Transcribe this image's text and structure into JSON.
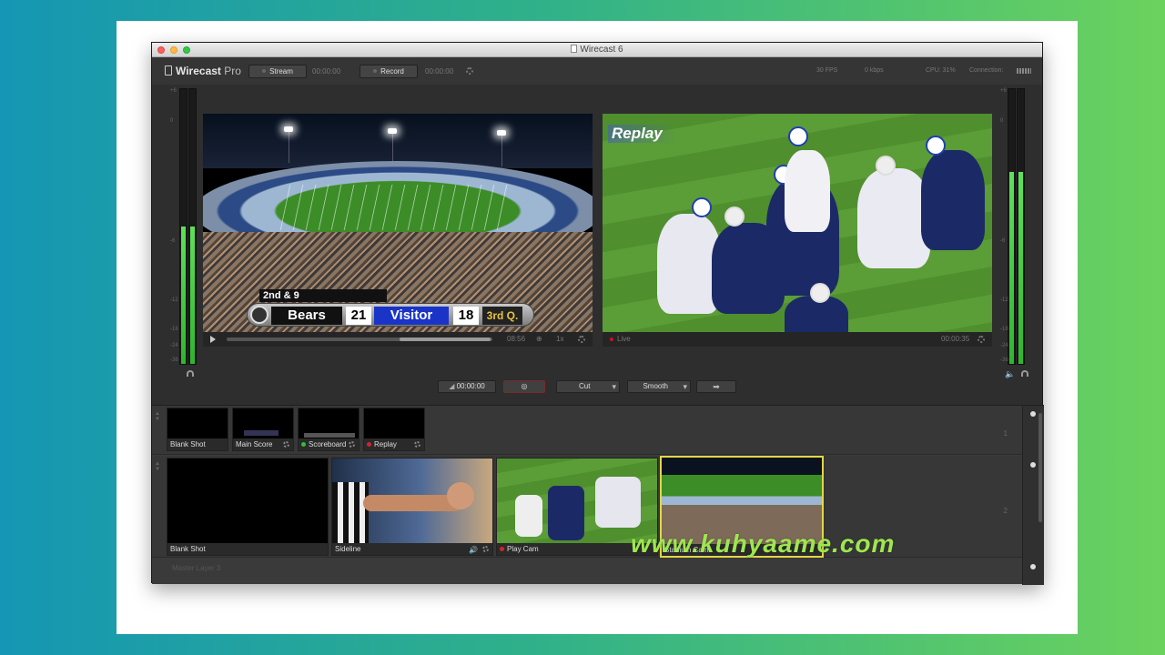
{
  "window": {
    "title": "Wirecast 6"
  },
  "toolbar": {
    "logo_main": "Wirecast",
    "logo_pro": "Pro",
    "stream_label": "Stream",
    "stream_time": "00:00:00",
    "record_label": "Record",
    "record_time": "00:00:00",
    "fps": "30 FPS",
    "kbps": "0 kbps",
    "cpu": "CPU:  31%",
    "connection": "Connection:"
  },
  "meters": {
    "left_scale": [
      "+6",
      "0",
      "-6",
      "-12",
      "-18",
      "-24",
      "-36"
    ],
    "right_scale": [
      "+6",
      "0",
      "-6",
      "-12",
      "-18",
      "-24",
      "-36"
    ],
    "left_level": 0.5,
    "right_level": 0.7
  },
  "preview": {
    "down_distance": "2nd & 9",
    "home_team": "Bears",
    "home_score": "21",
    "away_team": "Visitor",
    "away_score": "18",
    "quarter": "3rd Q.",
    "time": "08:56",
    "speed": "1x"
  },
  "live": {
    "overlay": "Replay",
    "status": "Live",
    "time": "00:00:35"
  },
  "transport": {
    "timecode": "00:00:00",
    "transition1": "Cut",
    "transition2": "Smooth"
  },
  "layer1": {
    "shots": [
      {
        "label": "Blank Shot"
      },
      {
        "label": "Main Score"
      },
      {
        "label": "Scoreboard",
        "dot": "#2fbf3a"
      },
      {
        "label": "Replay",
        "dot": "#d3262a"
      }
    ]
  },
  "layer2": {
    "shots": [
      {
        "label": "Blank Shot"
      },
      {
        "label": "Sideline"
      },
      {
        "label": "Play Cam",
        "dot": "#d3262a"
      },
      {
        "label": "Stadium Cam"
      }
    ]
  },
  "layers": {
    "num1": "1",
    "num2": "2",
    "master": "Master Layer 3"
  },
  "watermark": "www.kuhyaame.com"
}
